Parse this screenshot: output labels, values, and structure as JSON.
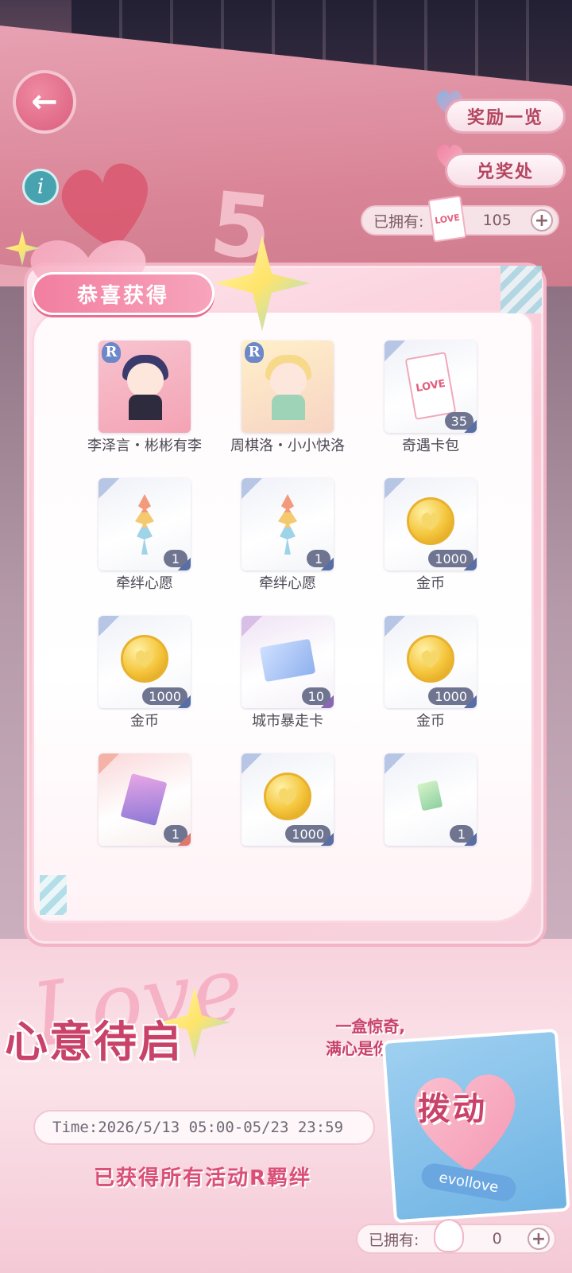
{
  "header": {
    "back_label": "←",
    "info_label": "i",
    "rewards_overview_label": "奖励一览",
    "redeem_label": "兑奖处",
    "owned_label": "已拥有:",
    "owned_value": "105",
    "plus_label": "+"
  },
  "panel": {
    "title": "恭喜获得",
    "items": [
      {
        "name": "李泽言・彬彬有李",
        "count": "",
        "badge": "R",
        "icon": "portrait-li-zeyan-icon"
      },
      {
        "name": "周棋洛・小小快洛",
        "count": "",
        "badge": "R",
        "icon": "portrait-zhou-qiluo-icon"
      },
      {
        "name": "奇遇卡包",
        "count": "35",
        "badge": "",
        "icon": "card-pack-icon"
      },
      {
        "name": "牵绊心愿",
        "count": "1",
        "badge": "",
        "icon": "paper-crane-icon"
      },
      {
        "name": "牵绊心愿",
        "count": "1",
        "badge": "",
        "icon": "paper-crane-icon"
      },
      {
        "name": "金币",
        "count": "1000",
        "badge": "",
        "icon": "gold-coin-icon"
      },
      {
        "name": "金币",
        "count": "1000",
        "badge": "",
        "icon": "gold-coin-icon"
      },
      {
        "name": "城市暴走卡",
        "count": "10",
        "badge": "",
        "icon": "paper-plane-card-icon"
      },
      {
        "name": "金币",
        "count": "1000",
        "badge": "",
        "icon": "gold-coin-icon"
      },
      {
        "name": "",
        "count": "1",
        "badge": "",
        "icon": "purple-card-icon"
      },
      {
        "name": "",
        "count": "1000",
        "badge": "",
        "icon": "gold-coin-icon"
      },
      {
        "name": "",
        "count": "1",
        "badge": "",
        "icon": "green-card-icon"
      }
    ]
  },
  "event": {
    "script_text": "Love",
    "title": "心意待启",
    "subtitle_line1": "一盒惊奇,",
    "subtitle_line2": "满心是你。",
    "time": "Time:2026/5/13 05:00-05/23 23:59",
    "status": "已获得所有活动R羁绊",
    "pull_label": "拨动",
    "brand": "evollove",
    "owned_label": "已拥有:",
    "owned_value": "0",
    "plus_label": "+"
  },
  "colors": {
    "accent_pink": "#f27ea0",
    "title_red": "#c9426a",
    "coin_gold": "#f4c53b",
    "count_tag": "#6f7590"
  }
}
